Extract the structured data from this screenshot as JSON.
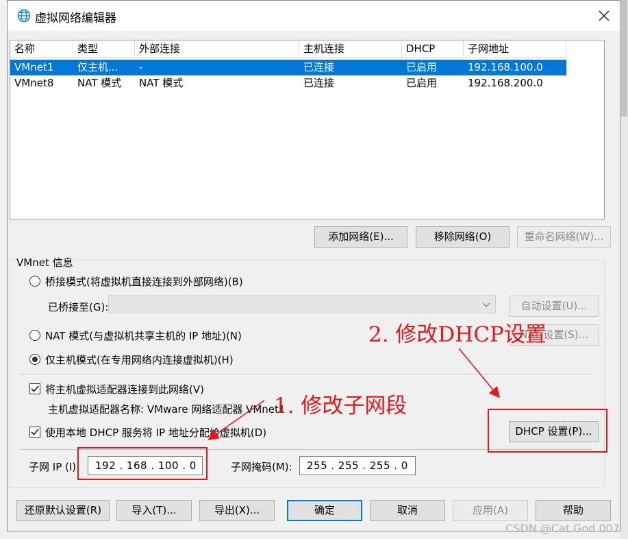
{
  "window": {
    "title": "虚拟网络编辑器"
  },
  "icons": {
    "title": "globe-icon",
    "close": "close-icon",
    "dropdown": "chevron-down-icon"
  },
  "colors": {
    "selection": "#0078d7",
    "annotation": "#e3181b"
  },
  "table": {
    "headers": [
      "名称",
      "类型",
      "外部连接",
      "主机连接",
      "DHCP",
      "子网地址"
    ],
    "rows": [
      {
        "name": "VMnet1",
        "type": "仅主机...",
        "external": "-",
        "host": "已连接",
        "dhcp": "已启用",
        "subnet": "192.168.100.0",
        "selected": true
      },
      {
        "name": "VMnet8",
        "type": "NAT 模式",
        "external": "NAT 模式",
        "host": "已连接",
        "dhcp": "已启用",
        "subnet": "192.168.200.0",
        "selected": false
      }
    ]
  },
  "list_buttons": {
    "add": "添加网络(E)...",
    "remove": "移除网络(O)",
    "rename": "重命名网络(W)..."
  },
  "vmnet_info": {
    "label": "VMnet 信息",
    "bridge_radio": "桥接模式(将虚拟机直接连接到外部网络)(B)",
    "bridged_to_label": "已桥接至(G):",
    "auto_settings": "自动设置(U)...",
    "nat_radio": "NAT 模式(与虚拟机共享主机的 IP 地址)(N)",
    "nat_settings": "NAT 设置(S)...",
    "hostonly_radio": "仅主机模式(在专用网络内连接虚拟机)(H)",
    "connect_adapter": "将主机虚拟适配器连接到此网络(V)",
    "adapter_name": "主机虚拟适配器名称: VMware 网络适配器 VMnet1",
    "use_dhcp": "使用本地 DHCP 服务将 IP 地址分配给虚拟机(D)",
    "dhcp_settings": "DHCP 设置(P)...",
    "subnet_ip_label": "子网 IP (I):",
    "subnet_ip": "192 . 168 . 100 .   0",
    "subnet_mask_label": "子网掩码(M):",
    "subnet_mask": "255 . 255 . 255 .   0"
  },
  "bottom_buttons": {
    "restore": "还原默认设置(R)",
    "import": "导入(T)...",
    "export": "导出(X)...",
    "ok": "确定",
    "cancel": "取消",
    "apply": "应用(A)",
    "help": "帮助"
  },
  "annotations": {
    "step1": "1. 修改子网段",
    "step2": "2. 修改DHCP设置"
  },
  "watermark": "CSDN @Cat God 007"
}
